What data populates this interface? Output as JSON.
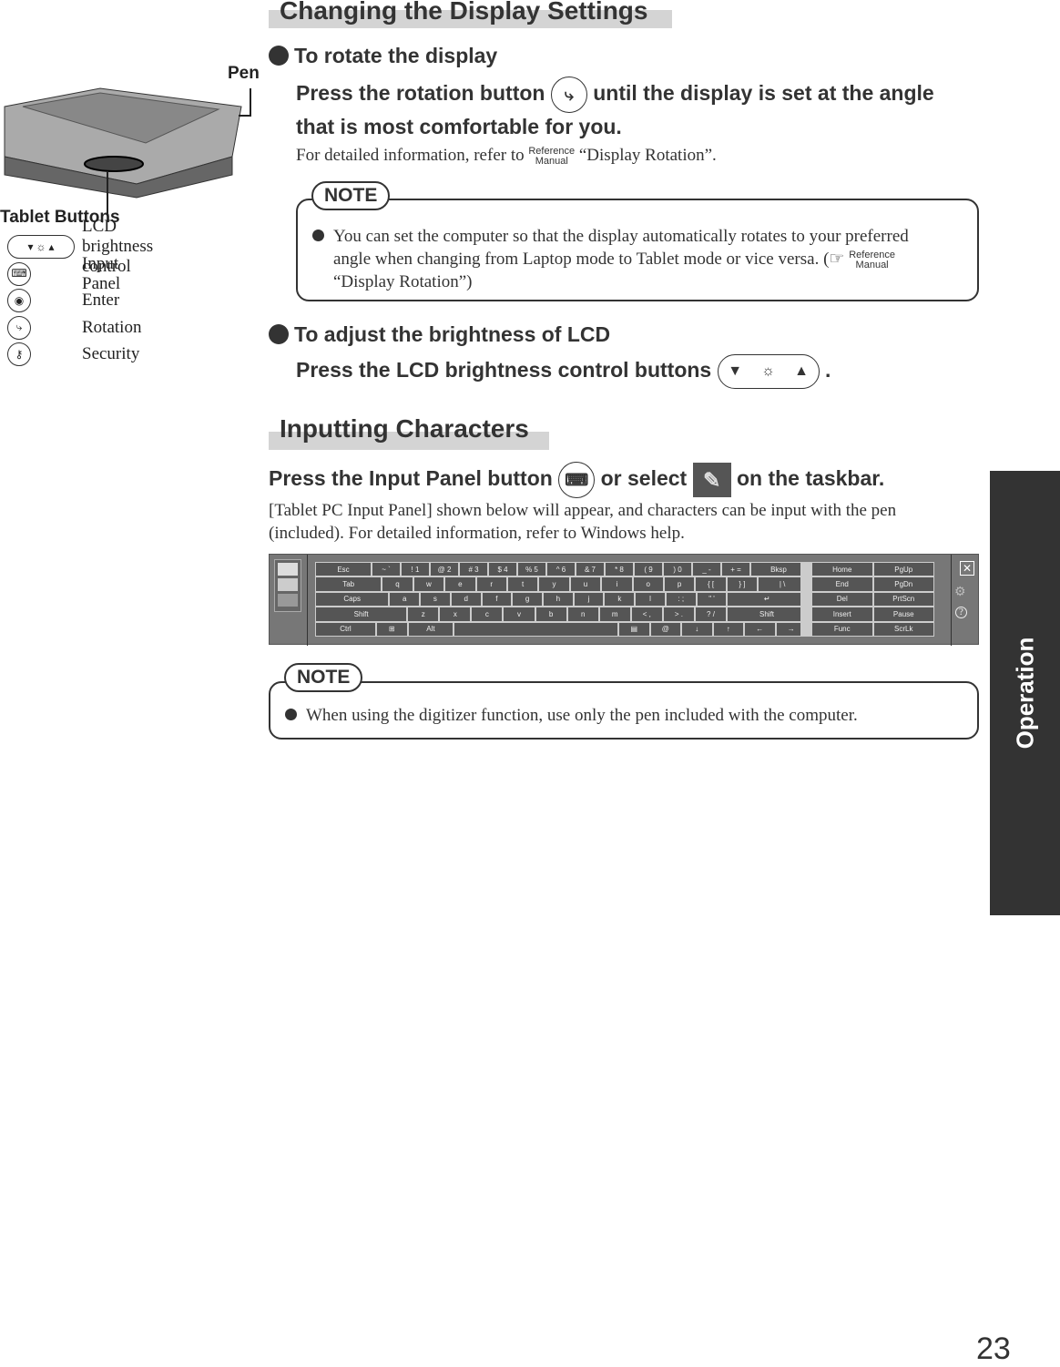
{
  "section1": {
    "title": "Changing the Display Settings",
    "rotate": {
      "heading": "To rotate the display",
      "instr_a": "Press the rotation button",
      "instr_b": "until the display is set at the angle",
      "instr_c": "that is most comfortable for you.",
      "detail_a": "For detailed information, refer to",
      "detail_b": "“Display Rotation”."
    },
    "note": {
      "label": "NOTE",
      "text_a": "You can set the computer so that the display automatically rotates to your preferred",
      "text_b": "angle when changing from Laptop mode to Tablet mode or vice versa. (",
      "text_c": "“Display Rotation”)"
    },
    "brightness": {
      "heading": "To adjust the brightness of LCD",
      "instr": "Press the LCD brightness control buttons",
      "period": "."
    }
  },
  "reference": {
    "line1": "Reference",
    "line2": "Manual"
  },
  "figure": {
    "pen_label": "Pen",
    "tablet_buttons_label": "Tablet Buttons",
    "buttons": [
      {
        "icon": "brightness-icon",
        "label": "LCD brightness control"
      },
      {
        "icon": "keyboard-icon",
        "label": "Input Panel"
      },
      {
        "icon": "enter-icon",
        "label": "Enter"
      },
      {
        "icon": "rotation-icon",
        "label": "Rotation"
      },
      {
        "icon": "key-icon",
        "label": "Security"
      }
    ]
  },
  "section2": {
    "title": "Inputting Characters",
    "instr_a": "Press the Input Panel button",
    "instr_b": "or select",
    "instr_c": "on the taskbar.",
    "body_a": "[Tablet PC Input Panel] shown below will appear, and characters can be input with the pen",
    "body_b": "(included). For detailed information, refer to Windows help.",
    "note": {
      "label": "NOTE",
      "text": "When using the digitizer function, use only the pen included with the computer."
    }
  },
  "keyboard": {
    "rows": [
      [
        "Esc",
        "~ `",
        "! 1",
        "@ 2",
        "# 3",
        "$ 4",
        "% 5",
        "^ 6",
        "& 7",
        "* 8",
        "( 9",
        ") 0",
        "_ -",
        "+ =",
        "Bksp"
      ],
      [
        "Tab",
        "q",
        "w",
        "e",
        "r",
        "t",
        "y",
        "u",
        "i",
        "o",
        "p",
        "{ [",
        "} ]",
        "| \\"
      ],
      [
        "Caps",
        "a",
        "s",
        "d",
        "f",
        "g",
        "h",
        "j",
        "k",
        "l",
        ": ;",
        "\" '",
        "↵"
      ],
      [
        "Shift",
        "z",
        "x",
        "c",
        "v",
        "b",
        "n",
        "m",
        "< ,",
        "> .",
        "? /",
        "Shift"
      ],
      [
        "Ctrl",
        "⊞",
        "Alt",
        " ",
        "▤",
        "@",
        "↓",
        "↑",
        "←",
        "→"
      ]
    ],
    "nav": [
      [
        "Home",
        "PgUp"
      ],
      [
        "End",
        "PgDn"
      ],
      [
        "Del",
        "PrtScn"
      ],
      [
        "Insert",
        "Pause"
      ],
      [
        "Func",
        "ScrLk"
      ]
    ],
    "close": "✕",
    "gear": "⚙",
    "help": "?"
  },
  "side_tab": "Operation",
  "page_number": "23"
}
